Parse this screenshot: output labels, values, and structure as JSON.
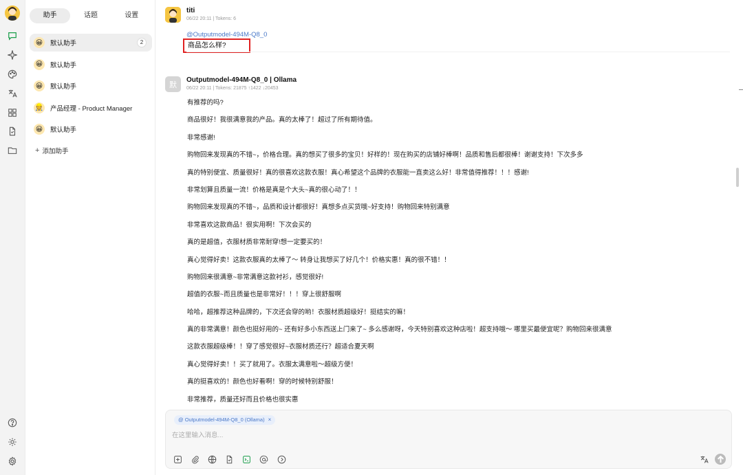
{
  "sidebar": {
    "tabs": [
      {
        "label": "助手"
      },
      {
        "label": "话题"
      },
      {
        "label": "设置"
      }
    ],
    "assistants": [
      {
        "label": "默认助手",
        "badge": "2"
      },
      {
        "label": "默认助手"
      },
      {
        "label": "默认助手"
      },
      {
        "label": "产品经理 - Product Manager"
      },
      {
        "label": "默认助手"
      }
    ],
    "add_label": "添加助手"
  },
  "messages": {
    "user": {
      "name": "titi",
      "meta": "06/22 20:11  |  Tokens: 6",
      "mention": "@Outputmodel-494M-Q8_0",
      "text": "商品怎么样?"
    },
    "bot": {
      "avatar_text": "默",
      "name": "Outputmodel-494M-Q8_0 | Ollama",
      "meta": "06/22 20:11  |  Tokens: 21875 ↑1422 ↓20453",
      "paragraphs": [
        "有推荐的吗?",
        "商品很好！我很满意我的产品。真的太棒了！超过了所有期待值。",
        "非常感谢!",
        "购物回来发现真的不错~，价格合理。真的想买了很多的宝贝！好样的！现在购买的店铺好棒啊！品质和售后都很棒！谢谢支持！下次多多",
        "真的特别便宜、质量很好！真的很喜欢这款衣服！真心希望这个品牌的衣服能一直卖这么好！非常值得推荐！！！感谢!",
        "非常划算且质量一流！价格是真是个大头~真的很心动了！！",
        "购物回来发现真的不错~，品质和设计都很好！真想多点买货哦~好支持！购物回来特别满意",
        "非常喜欢这款商品！很实用啊！下次会买的",
        "真的是超值，衣服材质非常耐穿!想一定要买的！",
        "真心觉得好卖！这款衣服真的太棒了～ 转身让我想买了好几个！价格实惠！真的很不错！！",
        "购物回来很满意~非常满意这款衬衫，感觉很好!",
        "超值的衣服~而且质量也是非常好！！！穿上很舒服啊",
        "哈哈，超推荐这种品牌的，下次还会穿的哟！衣服材质超级好！挺结实的嘛！",
        "真的非常满意！颜色也挺好用的~ 还有好多小东西送上门来了~ 多么感谢呀，今天特别喜欢这种店啦！超支持哦～ 哪里买最便宜呢？购物回来很满意",
        "这款衣服超级棒！！穿了感觉很好~衣服材质还行？超适合夏天啊",
        "真心觉得好卖！！买了就用了。衣服太满意啦～超级方便！",
        "真的挺喜欢的！颜色也好看啊！穿的时候特别舒服！",
        "非常推荐，质量还好而且价格也很实惠"
      ]
    }
  },
  "composer": {
    "chip_label": "@ Outputmodel-494M-Q8_0 (Ollama)",
    "chip_close": "×",
    "placeholder": "在这里输入消息..."
  },
  "colors": {
    "accent": "#1a9e4a",
    "mention": "#4a78c8",
    "highlight_box": "#e02020"
  }
}
